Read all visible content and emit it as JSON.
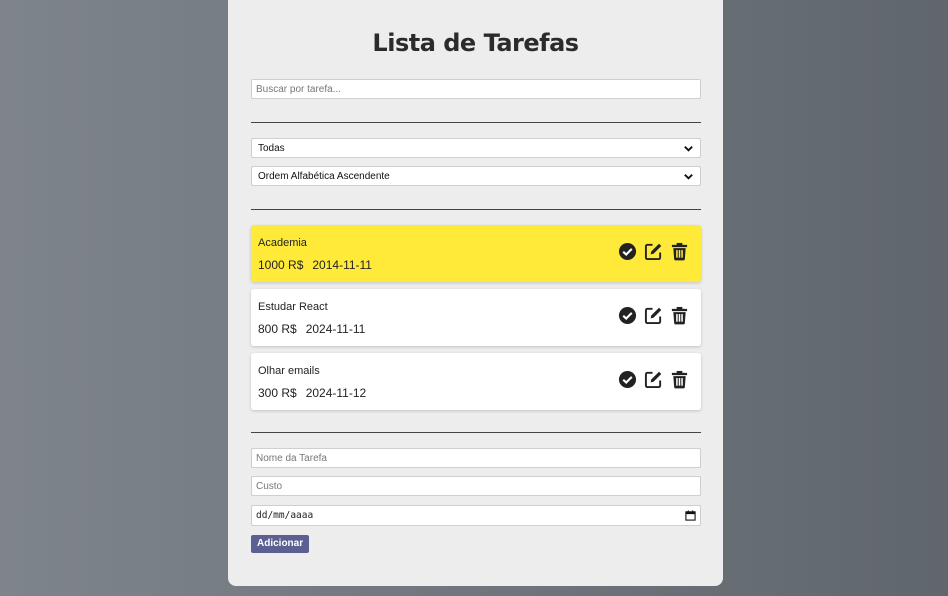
{
  "app": {
    "title": "Lista de Tarefas"
  },
  "search": {
    "placeholder": "Buscar por tarefa...",
    "value": ""
  },
  "filters": {
    "status_selected": "Todas",
    "order_selected": "Ordem Alfabética Ascendente"
  },
  "tasks": [
    {
      "name": "Academia",
      "cost": "1000 R$",
      "date": "2014-11-11",
      "highlighted": true
    },
    {
      "name": "Estudar React",
      "cost": "800 R$",
      "date": "2024-11-11",
      "highlighted": false
    },
    {
      "name": "Olhar emails",
      "cost": "300 R$",
      "date": "2024-11-12",
      "highlighted": false
    }
  ],
  "form": {
    "name_placeholder": "Nome da Tarefa",
    "cost_placeholder": "Custo",
    "date_placeholder": "dd/mm/aaaa",
    "submit_label": "Adicionar"
  },
  "colors": {
    "highlight": "#ffea3a",
    "button": "#5c5f92",
    "card": "#ededed"
  },
  "icons": {
    "complete": "check-circle-icon",
    "edit": "edit-icon",
    "delete": "trash-icon",
    "dropdown": "chevron-down-icon",
    "calendar": "calendar-icon"
  }
}
